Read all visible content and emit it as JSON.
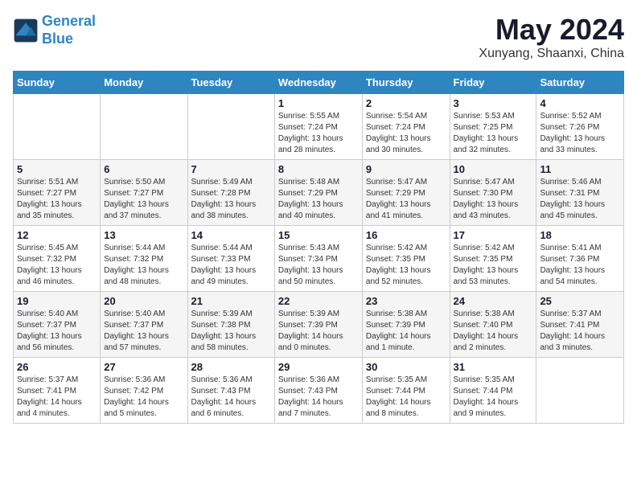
{
  "header": {
    "logo_line1": "General",
    "logo_line2": "Blue",
    "month": "May 2024",
    "location": "Xunyang, Shaanxi, China"
  },
  "weekdays": [
    "Sunday",
    "Monday",
    "Tuesday",
    "Wednesday",
    "Thursday",
    "Friday",
    "Saturday"
  ],
  "weeks": [
    [
      {
        "day": "",
        "info": ""
      },
      {
        "day": "",
        "info": ""
      },
      {
        "day": "",
        "info": ""
      },
      {
        "day": "1",
        "info": "Sunrise: 5:55 AM\nSunset: 7:24 PM\nDaylight: 13 hours\nand 28 minutes."
      },
      {
        "day": "2",
        "info": "Sunrise: 5:54 AM\nSunset: 7:24 PM\nDaylight: 13 hours\nand 30 minutes."
      },
      {
        "day": "3",
        "info": "Sunrise: 5:53 AM\nSunset: 7:25 PM\nDaylight: 13 hours\nand 32 minutes."
      },
      {
        "day": "4",
        "info": "Sunrise: 5:52 AM\nSunset: 7:26 PM\nDaylight: 13 hours\nand 33 minutes."
      }
    ],
    [
      {
        "day": "5",
        "info": "Sunrise: 5:51 AM\nSunset: 7:27 PM\nDaylight: 13 hours\nand 35 minutes."
      },
      {
        "day": "6",
        "info": "Sunrise: 5:50 AM\nSunset: 7:27 PM\nDaylight: 13 hours\nand 37 minutes."
      },
      {
        "day": "7",
        "info": "Sunrise: 5:49 AM\nSunset: 7:28 PM\nDaylight: 13 hours\nand 38 minutes."
      },
      {
        "day": "8",
        "info": "Sunrise: 5:48 AM\nSunset: 7:29 PM\nDaylight: 13 hours\nand 40 minutes."
      },
      {
        "day": "9",
        "info": "Sunrise: 5:47 AM\nSunset: 7:29 PM\nDaylight: 13 hours\nand 41 minutes."
      },
      {
        "day": "10",
        "info": "Sunrise: 5:47 AM\nSunset: 7:30 PM\nDaylight: 13 hours\nand 43 minutes."
      },
      {
        "day": "11",
        "info": "Sunrise: 5:46 AM\nSunset: 7:31 PM\nDaylight: 13 hours\nand 45 minutes."
      }
    ],
    [
      {
        "day": "12",
        "info": "Sunrise: 5:45 AM\nSunset: 7:32 PM\nDaylight: 13 hours\nand 46 minutes."
      },
      {
        "day": "13",
        "info": "Sunrise: 5:44 AM\nSunset: 7:32 PM\nDaylight: 13 hours\nand 48 minutes."
      },
      {
        "day": "14",
        "info": "Sunrise: 5:44 AM\nSunset: 7:33 PM\nDaylight: 13 hours\nand 49 minutes."
      },
      {
        "day": "15",
        "info": "Sunrise: 5:43 AM\nSunset: 7:34 PM\nDaylight: 13 hours\nand 50 minutes."
      },
      {
        "day": "16",
        "info": "Sunrise: 5:42 AM\nSunset: 7:35 PM\nDaylight: 13 hours\nand 52 minutes."
      },
      {
        "day": "17",
        "info": "Sunrise: 5:42 AM\nSunset: 7:35 PM\nDaylight: 13 hours\nand 53 minutes."
      },
      {
        "day": "18",
        "info": "Sunrise: 5:41 AM\nSunset: 7:36 PM\nDaylight: 13 hours\nand 54 minutes."
      }
    ],
    [
      {
        "day": "19",
        "info": "Sunrise: 5:40 AM\nSunset: 7:37 PM\nDaylight: 13 hours\nand 56 minutes."
      },
      {
        "day": "20",
        "info": "Sunrise: 5:40 AM\nSunset: 7:37 PM\nDaylight: 13 hours\nand 57 minutes."
      },
      {
        "day": "21",
        "info": "Sunrise: 5:39 AM\nSunset: 7:38 PM\nDaylight: 13 hours\nand 58 minutes."
      },
      {
        "day": "22",
        "info": "Sunrise: 5:39 AM\nSunset: 7:39 PM\nDaylight: 14 hours\nand 0 minutes."
      },
      {
        "day": "23",
        "info": "Sunrise: 5:38 AM\nSunset: 7:39 PM\nDaylight: 14 hours\nand 1 minute."
      },
      {
        "day": "24",
        "info": "Sunrise: 5:38 AM\nSunset: 7:40 PM\nDaylight: 14 hours\nand 2 minutes."
      },
      {
        "day": "25",
        "info": "Sunrise: 5:37 AM\nSunset: 7:41 PM\nDaylight: 14 hours\nand 3 minutes."
      }
    ],
    [
      {
        "day": "26",
        "info": "Sunrise: 5:37 AM\nSunset: 7:41 PM\nDaylight: 14 hours\nand 4 minutes."
      },
      {
        "day": "27",
        "info": "Sunrise: 5:36 AM\nSunset: 7:42 PM\nDaylight: 14 hours\nand 5 minutes."
      },
      {
        "day": "28",
        "info": "Sunrise: 5:36 AM\nSunset: 7:43 PM\nDaylight: 14 hours\nand 6 minutes."
      },
      {
        "day": "29",
        "info": "Sunrise: 5:36 AM\nSunset: 7:43 PM\nDaylight: 14 hours\nand 7 minutes."
      },
      {
        "day": "30",
        "info": "Sunrise: 5:35 AM\nSunset: 7:44 PM\nDaylight: 14 hours\nand 8 minutes."
      },
      {
        "day": "31",
        "info": "Sunrise: 5:35 AM\nSunset: 7:44 PM\nDaylight: 14 hours\nand 9 minutes."
      },
      {
        "day": "",
        "info": ""
      }
    ]
  ]
}
